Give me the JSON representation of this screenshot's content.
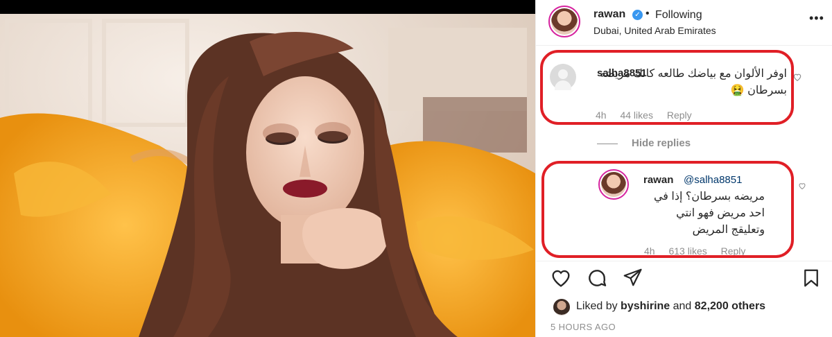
{
  "post": {
    "username": "rawan",
    "verified_icon": "verified-check-icon",
    "dot": "•",
    "follow_status": "Following",
    "location": "Dubai, United Arab Emirates",
    "more_icon": "ellipsis-icon"
  },
  "comments": [
    {
      "username": "salha8851",
      "text": "اوفر الألوان مع بياضك طالعه كانك مريضه بسرطان 🤮",
      "time": "4h",
      "likes": "44 likes",
      "reply": "Reply"
    }
  ],
  "hide_replies": "Hide replies",
  "reply": {
    "username": "rawan",
    "mention": "@salha8851",
    "text": "مريضه بسرطان؟ إذا في احد مريض فهو انتي وتعليقج المريض",
    "time": "4h",
    "likes": "613 likes",
    "reply": "Reply"
  },
  "actions": {
    "like_icon": "heart-icon",
    "comment_icon": "comment-icon",
    "share_icon": "send-icon",
    "save_icon": "bookmark-icon"
  },
  "likes_summary": {
    "prefix": "Liked by ",
    "user": "byshirine",
    "middle": " and ",
    "count": "82,200 others"
  },
  "time_ago": "5 HOURS AGO",
  "colors": {
    "annotation": "#e01f26",
    "dress": "#f0a31c",
    "link": "#00376b",
    "verified": "#3897f0"
  }
}
